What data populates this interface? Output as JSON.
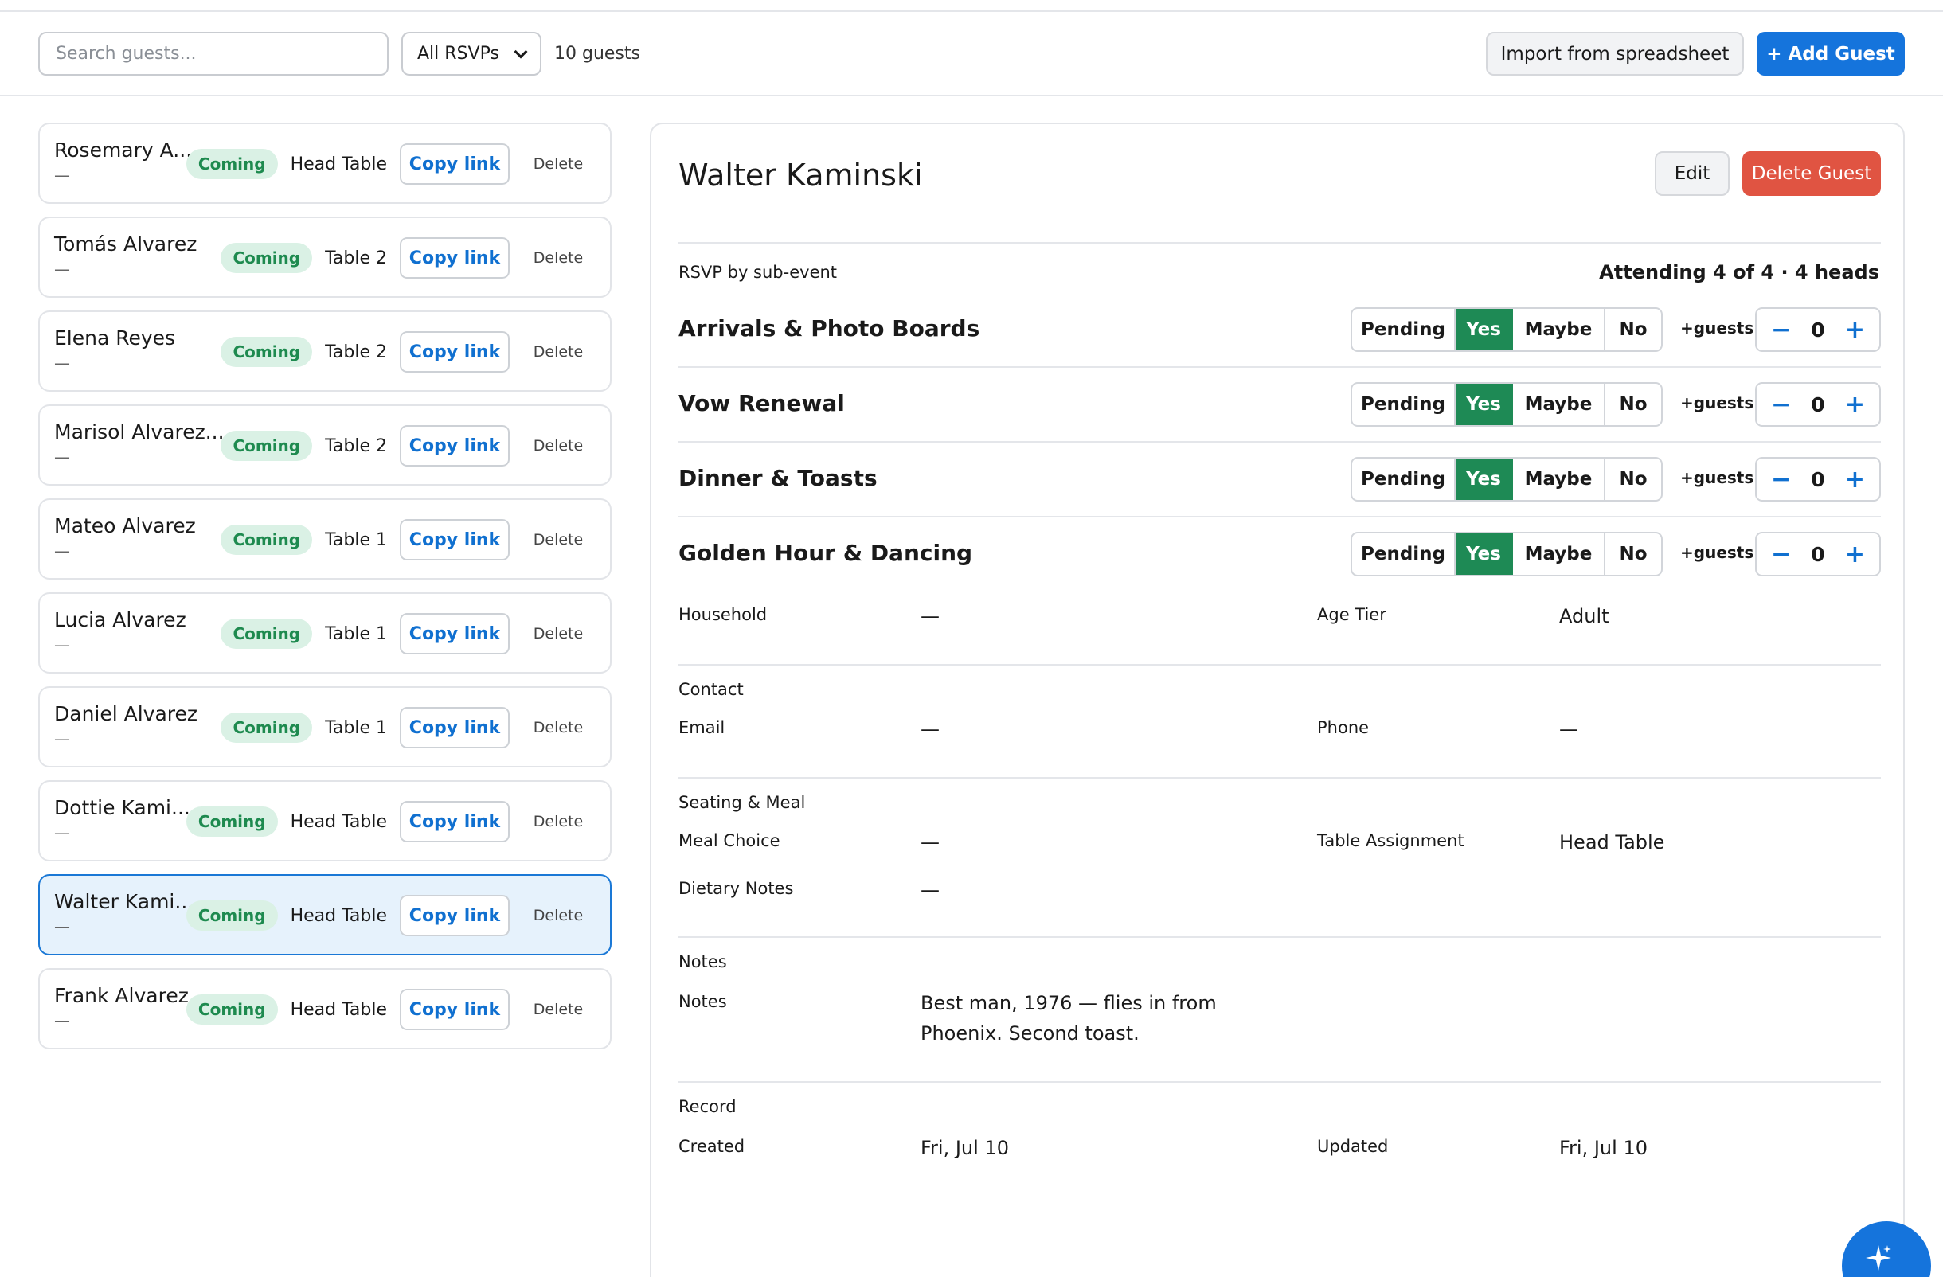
{
  "toolbar": {
    "search_placeholder": "Search guests...",
    "rsvp_filter": "All RSVPs",
    "guest_count": "10 guests",
    "import_label": "Import from spreadsheet",
    "add_label": "+ Add Guest"
  },
  "guests": [
    {
      "name": "Rosemary A...",
      "sub": "—",
      "status": "Coming",
      "table": "Head Table",
      "copy": "Copy link",
      "delete": "Delete"
    },
    {
      "name": "Tomás Alvarez",
      "sub": "—",
      "status": "Coming",
      "table": "Table 2",
      "copy": "Copy link",
      "delete": "Delete"
    },
    {
      "name": "Elena Reyes",
      "sub": "—",
      "status": "Coming",
      "table": "Table 2",
      "copy": "Copy link",
      "delete": "Delete"
    },
    {
      "name": "Marisol Alvarez...",
      "sub": "—",
      "status": "Coming",
      "table": "Table 2",
      "copy": "Copy link",
      "delete": "Delete"
    },
    {
      "name": "Mateo Alvarez",
      "sub": "—",
      "status": "Coming",
      "table": "Table 1",
      "copy": "Copy link",
      "delete": "Delete"
    },
    {
      "name": "Lucia Alvarez",
      "sub": "—",
      "status": "Coming",
      "table": "Table 1",
      "copy": "Copy link",
      "delete": "Delete"
    },
    {
      "name": "Daniel Alvarez",
      "sub": "—",
      "status": "Coming",
      "table": "Table 1",
      "copy": "Copy link",
      "delete": "Delete"
    },
    {
      "name": "Dottie Kami...",
      "sub": "—",
      "status": "Coming",
      "table": "Head Table",
      "copy": "Copy link",
      "delete": "Delete"
    },
    {
      "name": "Walter Kami...",
      "sub": "—",
      "status": "Coming",
      "table": "Head Table",
      "copy": "Copy link",
      "delete": "Delete"
    },
    {
      "name": "Frank Alvarez",
      "sub": "—",
      "status": "Coming",
      "table": "Head Table",
      "copy": "Copy link",
      "delete": "Delete"
    }
  ],
  "detail": {
    "name": "Walter Kaminski",
    "edit_label": "Edit",
    "delete_label": "Delete Guest",
    "rsvp_heading": "RSVP by sub-event",
    "attending": "Attending 4 of 4 · 4 heads",
    "rsvp_options": [
      "Pending",
      "Yes",
      "Maybe",
      "No"
    ],
    "plus_guests_label": "+guests",
    "sub_events": [
      {
        "name": "Arrivals & Photo Boards",
        "selected": "Yes",
        "extra_guests": "0"
      },
      {
        "name": "Vow Renewal",
        "selected": "Yes",
        "extra_guests": "0"
      },
      {
        "name": "Dinner & Toasts",
        "selected": "Yes",
        "extra_guests": "0"
      },
      {
        "name": "Golden Hour & Dancing",
        "selected": "Yes",
        "extra_guests": "0"
      }
    ],
    "household_label": "Household",
    "household_value": "—",
    "age_tier_label": "Age Tier",
    "age_tier_value": "Adult",
    "contact_heading": "Contact",
    "email_label": "Email",
    "email_value": "—",
    "phone_label": "Phone",
    "phone_value": "—",
    "seating_heading": "Seating & Meal",
    "meal_label": "Meal Choice",
    "meal_value": "—",
    "table_label": "Table Assignment",
    "table_value": "Head Table",
    "dietary_label": "Dietary Notes",
    "dietary_value": "—",
    "notes_heading": "Notes",
    "notes_label": "Notes",
    "notes_line1": "Best man, 1976 — flies in from",
    "notes_line2": "Phoenix. Second toast.",
    "record_heading": "Record",
    "created_label": "Created",
    "created_value": "Fri, Jul 10",
    "updated_label": "Updated",
    "updated_value": "Fri, Jul 10"
  },
  "icons": {
    "fab": "sparkle-icon"
  },
  "colors": {
    "accent": "#1574dc",
    "danger": "#e05442",
    "yes": "#1e8a55",
    "coming_badge_bg": "#daf1e5",
    "coming_badge_text": "#1e8a4f",
    "selected_bg": "#e6f2fc"
  }
}
